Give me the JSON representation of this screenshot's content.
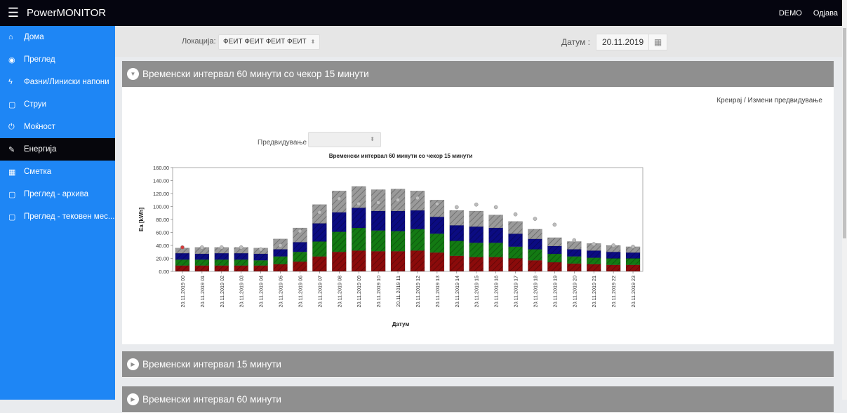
{
  "header": {
    "menu_icon": "hamburger-icon",
    "app_title": "PowerMONITOR",
    "user": "DEMO",
    "logout": "Одјава"
  },
  "sidebar": {
    "items": [
      {
        "label": "Дома",
        "icon": "home-icon",
        "glyph": "⌂",
        "active": false
      },
      {
        "label": "Преглед",
        "icon": "dashboard-icon",
        "glyph": "◉",
        "active": false
      },
      {
        "label": "Фазни/Линиски напони",
        "icon": "bolt-icon",
        "glyph": "ϟ",
        "active": false
      },
      {
        "label": "Струи",
        "icon": "file-icon",
        "glyph": "▢",
        "active": false
      },
      {
        "label": "Моќност",
        "icon": "power-icon",
        "glyph": "⏻",
        "active": false
      },
      {
        "label": "Енергија",
        "icon": "plug-icon",
        "glyph": "✎",
        "active": true
      },
      {
        "label": "Сметка",
        "icon": "calculator-icon",
        "glyph": "▦",
        "active": false
      },
      {
        "label": "Преглед - архива",
        "icon": "file-icon",
        "glyph": "▢",
        "active": false
      },
      {
        "label": "Преглед - тековен мес...",
        "icon": "file-icon",
        "glyph": "▢",
        "active": false
      }
    ]
  },
  "filters": {
    "location_label": "Локација:",
    "location_value": "ФЕИТ ФЕИТ ФЕИТ ФЕИТ",
    "date_label": "Датум :",
    "date_value": "20.11.2019"
  },
  "panels": [
    {
      "title": "Временски интервал 60 минути со чекор 15 минути",
      "expanded": true
    },
    {
      "title": "Временски интервал 15 минути",
      "expanded": false
    },
    {
      "title": "Временски интервал 60 минути",
      "expanded": false
    }
  ],
  "edit_link": "Креирај / Измени предвидување",
  "forecast_label": "Предвидување",
  "forecast_value": "",
  "chart_data": {
    "type": "bar",
    "title": "Временски интервал 60 минути со чекор 15 минути",
    "xlabel": "Датум",
    "ylabel": "Ea [kWh]",
    "ylim": [
      0,
      160
    ],
    "yticks": [
      "0.00",
      "20.00",
      "40.00",
      "60.00",
      "80.00",
      "100.00",
      "120.00",
      "140.00",
      "160.00"
    ],
    "categories": [
      "20.11.2019 00",
      "20.11.2019 01",
      "20.11.2019 02",
      "20.11.2019 03",
      "20.11.2019 04",
      "20.11.2019 05",
      "20.11.2019 06",
      "20.11.2019 07",
      "20.11.2019 08",
      "20.11.2019 09",
      "20.11.2019 10",
      "20.11.2019 11",
      "20.11.2019 12",
      "20.11.2019 13",
      "20.11.2019 14",
      "20.11.2019 15",
      "20.11.2019 16",
      "20.11.2019 17",
      "20.11.2019 18",
      "20.11.2019 19",
      "20.11.2019 20",
      "20.11.2019 21",
      "20.11.2019 22",
      "20.11.2019 23"
    ],
    "stacked": true,
    "series": [
      {
        "color": "#8b0b0b",
        "values": [
          9,
          9,
          9,
          9,
          9,
          11,
          15,
          23,
          30,
          32,
          31,
          31,
          32,
          29,
          24,
          22,
          22,
          20,
          17,
          14,
          12,
          11,
          10,
          10
        ]
      },
      {
        "color": "#137a13",
        "values": [
          9,
          9,
          9,
          9,
          8,
          12,
          15,
          23,
          31,
          35,
          32,
          31,
          33,
          29,
          23,
          22,
          22,
          18,
          17,
          13,
          11,
          10,
          10,
          10
        ]
      },
      {
        "color": "#0b0b82",
        "values": [
          10,
          9,
          10,
          10,
          10,
          11,
          15,
          28,
          30,
          31,
          30,
          31,
          29,
          26,
          24,
          25,
          23,
          20,
          16,
          12,
          11,
          11,
          10,
          9
        ]
      },
      {
        "color": "#9a9a9a",
        "values": [
          8,
          10,
          9,
          9,
          9,
          16,
          22,
          29,
          33,
          33,
          33,
          34,
          30,
          26,
          23,
          24,
          20,
          19,
          15,
          13,
          12,
          11,
          10,
          9
        ]
      }
    ],
    "forecast": [
      37,
      37,
      37,
      37,
      34,
      40,
      62,
      91,
      112,
      104,
      106,
      110,
      113,
      104,
      99,
      103,
      99,
      88,
      81,
      72,
      48,
      42,
      40,
      38
    ],
    "forecast_first_color": "#d33a3a",
    "forecast_color": "#bdbdbd"
  }
}
